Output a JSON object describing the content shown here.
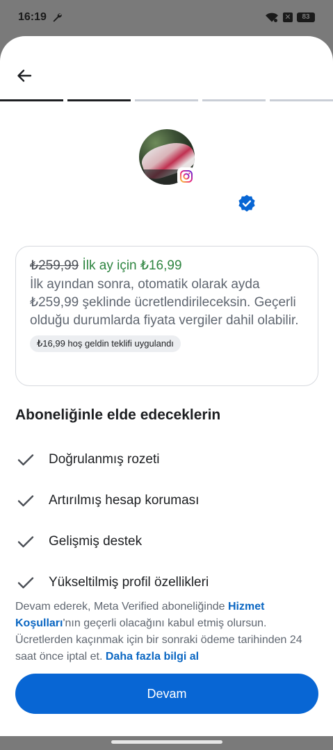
{
  "status_bar": {
    "time": "16:19",
    "battery": "83",
    "icons": [
      "wrench-icon",
      "wifi-icon",
      "x-icon",
      "battery-icon"
    ]
  },
  "header": {
    "back_icon": "arrow-left-icon",
    "progress_steps_total": 5,
    "progress_steps_done": 2
  },
  "profile": {
    "platform_badge_icon": "instagram-icon",
    "verified_icon": "verified-badge-icon"
  },
  "pricing": {
    "old_price": "₺259,99",
    "promo_text": "İlk ay için ₺16,99",
    "description": "İlk ayından sonra, otomatik olarak ayda ₺259,99 şeklinde ücretlendirileceksin. Geçerli olduğu durumlarda fiyata vergiler dahil olabilir.",
    "offer_chip": "₺16,99 hoş geldin teklifi uygulandı"
  },
  "benefits": {
    "title": "Aboneliğinle elde edeceklerin",
    "items": [
      "Doğrulanmış rozeti",
      "Artırılmış hesap koruması",
      "Gelişmiş destek",
      "Yükseltilmiş profil özellikleri"
    ]
  },
  "terms": {
    "part1": "Devam ederek, Meta Verified aboneliğinde ",
    "link1": "Hizmet Koşulları",
    "part2": "'nın geçerli olacağını kabul etmiş olursun. Ücretlerden kaçınmak için bir sonraki ödeme tarihinden 24 saat önce iptal et. ",
    "link2": "Daha fazla bilgi al"
  },
  "actions": {
    "continue_label": "Devam"
  },
  "colors": {
    "primary": "#0866d4",
    "promo_green": "#2e8540",
    "link_blue": "#0a66c2"
  }
}
